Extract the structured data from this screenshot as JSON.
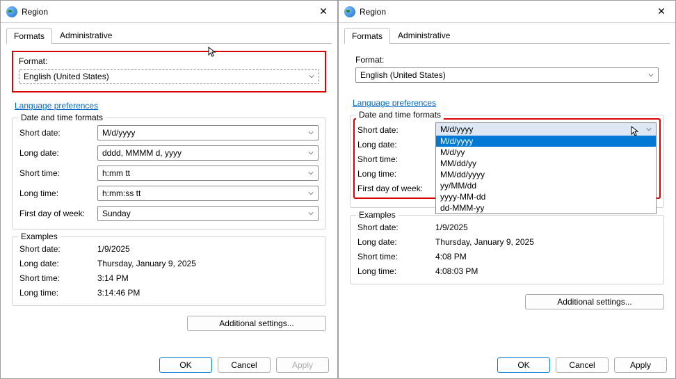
{
  "window": {
    "title": "Region",
    "close": "✕"
  },
  "tabs": {
    "formats": "Formats",
    "administrative": "Administrative"
  },
  "format_section": {
    "label": "Format:",
    "value": "English (United States)"
  },
  "language_link": "Language preferences",
  "dtf": {
    "legend": "Date and time formats",
    "short_date_label": "Short date:",
    "short_date_value": "M/d/yyyy",
    "long_date_label": "Long date:",
    "long_date_value": "dddd, MMMM d, yyyy",
    "short_time_label": "Short time:",
    "short_time_value": "h:mm tt",
    "long_time_label": "Long time:",
    "long_time_value": "h:mm:ss tt",
    "first_day_label": "First day of week:",
    "first_day_value": "Sunday"
  },
  "examples_left": {
    "legend": "Examples",
    "short_date_label": "Short date:",
    "short_date_value": "1/9/2025",
    "long_date_label": "Long date:",
    "long_date_value": "Thursday, January 9, 2025",
    "short_time_label": "Short time:",
    "short_time_value": "3:14 PM",
    "long_time_label": "Long time:",
    "long_time_value": "3:14:46 PM"
  },
  "examples_right": {
    "legend": "Examples",
    "short_date_label": "Short date:",
    "short_date_value": "1/9/2025",
    "long_date_label": "Long date:",
    "long_date_value": "Thursday, January 9, 2025",
    "short_time_label": "Short time:",
    "short_time_value": "4:08 PM",
    "long_time_label": "Long time:",
    "long_time_value": "4:08:03 PM"
  },
  "dropdown": {
    "selected": "M/d/yyyy",
    "options": [
      "M/d/yyyy",
      "M/d/yy",
      "MM/dd/yy",
      "MM/dd/yyyy",
      "yy/MM/dd",
      "yyyy-MM-dd",
      "dd-MMM-yy"
    ]
  },
  "buttons": {
    "additional": "Additional settings...",
    "ok": "OK",
    "cancel": "Cancel",
    "apply": "Apply"
  }
}
